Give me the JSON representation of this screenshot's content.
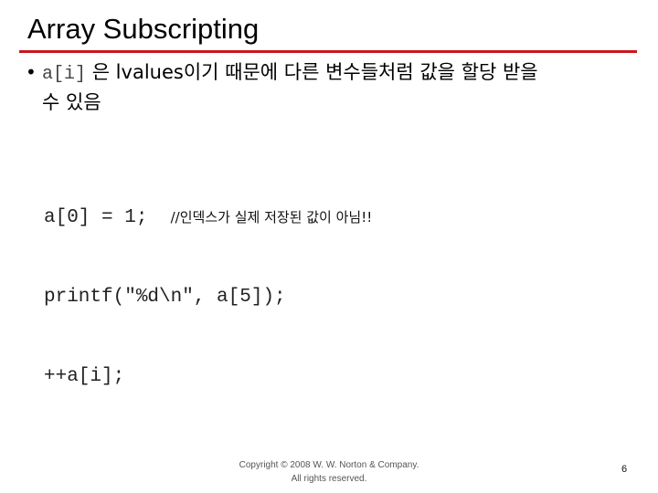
{
  "slide": {
    "title": "Array Subscripting",
    "accent_color": "#c8161d",
    "bullet": {
      "code_fragment": "a[i]",
      "text_part1": " 은 lvalues이기 때문에 다른 변수들처럼 값을 할당 받을",
      "text_part2": "수 있음"
    },
    "code": {
      "line1_code": "a[0] = 1;  ",
      "line1_comment": "//인덱스가 실제 저장된 값이 아님!!",
      "line2": "printf(\"%d\\n\", a[5]);",
      "line3": "++a[i];"
    },
    "footer": {
      "copyright_line1": "Copyright © 2008 W. W. Norton & Company.",
      "copyright_line2": "All rights reserved.",
      "page_number": "6"
    }
  }
}
